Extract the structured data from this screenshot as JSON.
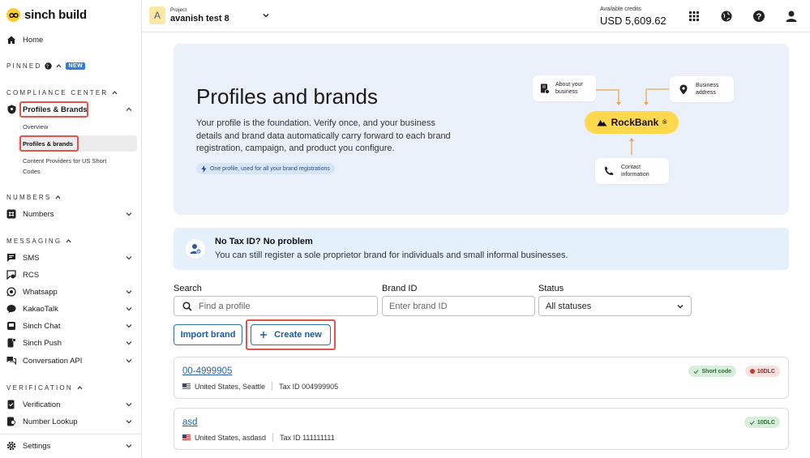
{
  "brand": {
    "name": "sinch build"
  },
  "sidebar": {
    "home": "Home",
    "pinned_label": "PINNED",
    "new_badge": "NEW",
    "compliance_label": "COMPLIANCE CENTER",
    "profiles_brands": "Profiles & Brands",
    "overview": "Overview",
    "profiles_brands_sub": "Profiles & brands",
    "content_providers_line1": "Content Providers for US Short",
    "content_providers_line2": "Codes",
    "numbers_label": "NUMBERS",
    "numbers": "Numbers",
    "messaging_label": "MESSAGING",
    "sms": "SMS",
    "rcs": "RCS",
    "whatsapp": "Whatsapp",
    "kakaotalk": "KakaoTalk",
    "sinch_chat": "Sinch Chat",
    "sinch_push": "Sinch Push",
    "conversation_api": "Conversation API",
    "verification_label": "VERIFICATION",
    "verification": "Verification",
    "number_lookup": "Number Lookup",
    "settings": "Settings"
  },
  "topbar": {
    "project_initial": "A",
    "project_label": "Project",
    "project_name": "avanish test 8",
    "credits_label": "Available credits",
    "credits_value": "USD 5,609.62",
    "icons": [
      "apps-grid-icon",
      "globe-icon",
      "help-icon",
      "account-icon"
    ]
  },
  "hero": {
    "title": "Profiles and brands",
    "description": "Your profile is the foundation. Verify once, and your business details and brand data automatically carry forward to each brand registration, campaign, and product you configure.",
    "chip": "One profile, used for all your brand registrations",
    "diagram": {
      "about_line1": "About your",
      "about_line2": "business",
      "address_line1": "Business",
      "address_line2": "address",
      "contact_line1": "Contact",
      "contact_line2": "information",
      "center_label": "RockBank",
      "center_mark": "®"
    }
  },
  "notice": {
    "title": "No Tax ID? No problem",
    "text": "You can still register a sole proprietor brand for individuals and small informal businesses."
  },
  "filters": {
    "search_label": "Search",
    "search_placeholder": "Find a profile",
    "brand_id_label": "Brand ID",
    "brand_id_placeholder": "Enter brand ID",
    "status_label": "Status",
    "status_value": "All statuses"
  },
  "actions": {
    "import_brand": "Import brand",
    "create_new": "Create new"
  },
  "profiles": [
    {
      "id": "00-4999905",
      "location": "United States, Seattle",
      "tax_id": "Tax ID 004999905",
      "badges": [
        "Short code",
        "10DLC"
      ]
    },
    {
      "id": "asd",
      "location": "United States, asdasd",
      "tax_id": "Tax ID 111111111",
      "badges": [
        "10DLC"
      ]
    }
  ],
  "colors": {
    "accent": "#2f6fb3",
    "highlight": "#e5534b",
    "brand_yellow": "#ffcd2e",
    "hero_bg": "#eaf1fa"
  }
}
